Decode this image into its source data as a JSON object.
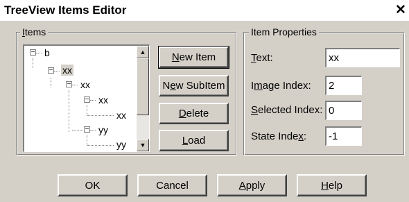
{
  "window": {
    "title": "TreeView Items Editor",
    "close_glyph": "✕"
  },
  "items_group": {
    "label": "Items",
    "tree": [
      {
        "text": "b",
        "expander": "−",
        "selected": false
      },
      {
        "text": "xx",
        "expander": "−",
        "selected": true
      },
      {
        "text": "xx",
        "expander": "−",
        "selected": false
      },
      {
        "text": "xx",
        "expander": "−",
        "selected": false
      },
      {
        "text": "xx",
        "expander": "",
        "selected": false
      },
      {
        "text": "yy",
        "expander": "−",
        "selected": false
      },
      {
        "text": "yy",
        "expander": "",
        "selected": false
      }
    ],
    "scroll_up_glyph": "▲",
    "scroll_down_glyph": "▼",
    "buttons": {
      "new_item": "New Item",
      "new_subitem": "New SubItem",
      "delete": "Delete",
      "load": "Load"
    }
  },
  "properties_group": {
    "label": "Item Properties",
    "text_label": "Text:",
    "text_value": "xx",
    "image_index_label": "Image Index:",
    "image_index_value": "2",
    "selected_index_label": "Selected Index:",
    "selected_index_value": "0",
    "state_index_label": "State Index:",
    "state_index_value": "-1"
  },
  "footer": {
    "ok": "OK",
    "cancel": "Cancel",
    "apply": "Apply",
    "help": "Help"
  }
}
